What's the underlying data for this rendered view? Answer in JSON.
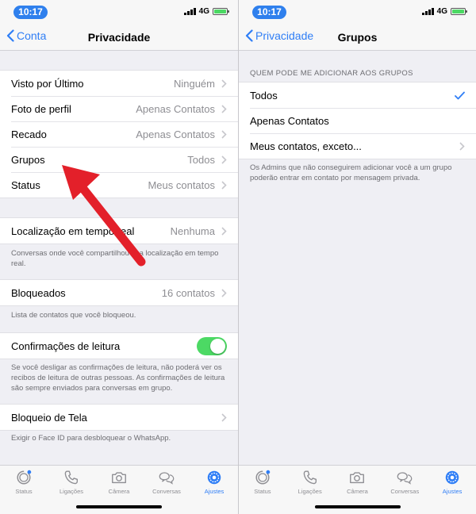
{
  "colors": {
    "accent": "#2f7ef6",
    "time_pill": "#2f80ed",
    "toggle_on": "#4cd964",
    "arrow": "#e3202a"
  },
  "left": {
    "status": {
      "time": "10:17",
      "network": "4G"
    },
    "nav": {
      "back_label": "Conta",
      "title": "Privacidade"
    },
    "rows1": [
      {
        "label": "Visto por Último",
        "value": "Ninguém"
      },
      {
        "label": "Foto de perfil",
        "value": "Apenas Contatos"
      },
      {
        "label": "Recado",
        "value": "Apenas Contatos"
      },
      {
        "label": "Grupos",
        "value": "Todos"
      },
      {
        "label": "Status",
        "value": "Meus contatos"
      }
    ],
    "location": {
      "label": "Localização em tempo real",
      "value": "Nenhuma",
      "footer": "Conversas onde você compartilhou sua localização em tempo real."
    },
    "blocked": {
      "label": "Bloqueados",
      "value": "16 contatos",
      "footer": "Lista de contatos que você bloqueou."
    },
    "read_receipts": {
      "label": "Confirmações de leitura",
      "footer": "Se você desligar as confirmações de leitura, não poderá ver os recibos de leitura de outras pessoas. As confirmações de leitura são sempre enviados para conversas em grupo."
    },
    "screen_lock": {
      "label": "Bloqueio de Tela",
      "footer": "Exigir o Face ID para desbloquear o WhatsApp."
    }
  },
  "right": {
    "status": {
      "time": "10:17",
      "network": "4G"
    },
    "nav": {
      "back_label": "Privacidade",
      "title": "Grupos"
    },
    "section_header": "QUEM PODE ME ADICIONAR AOS GRUPOS",
    "options": [
      {
        "label": "Todos"
      },
      {
        "label": "Apenas Contatos"
      },
      {
        "label": "Meus contatos, exceto..."
      }
    ],
    "footer": "Os Admins que não conseguirem adicionar você a um grupo poderão entrar em contato por mensagem privada."
  },
  "tabs": [
    {
      "label": "Status",
      "icon": "status-icon"
    },
    {
      "label": "Ligações",
      "icon": "phone-icon"
    },
    {
      "label": "Câmera",
      "icon": "camera-icon"
    },
    {
      "label": "Conversas",
      "icon": "chat-icon"
    },
    {
      "label": "Ajustes",
      "icon": "gear-icon"
    }
  ]
}
